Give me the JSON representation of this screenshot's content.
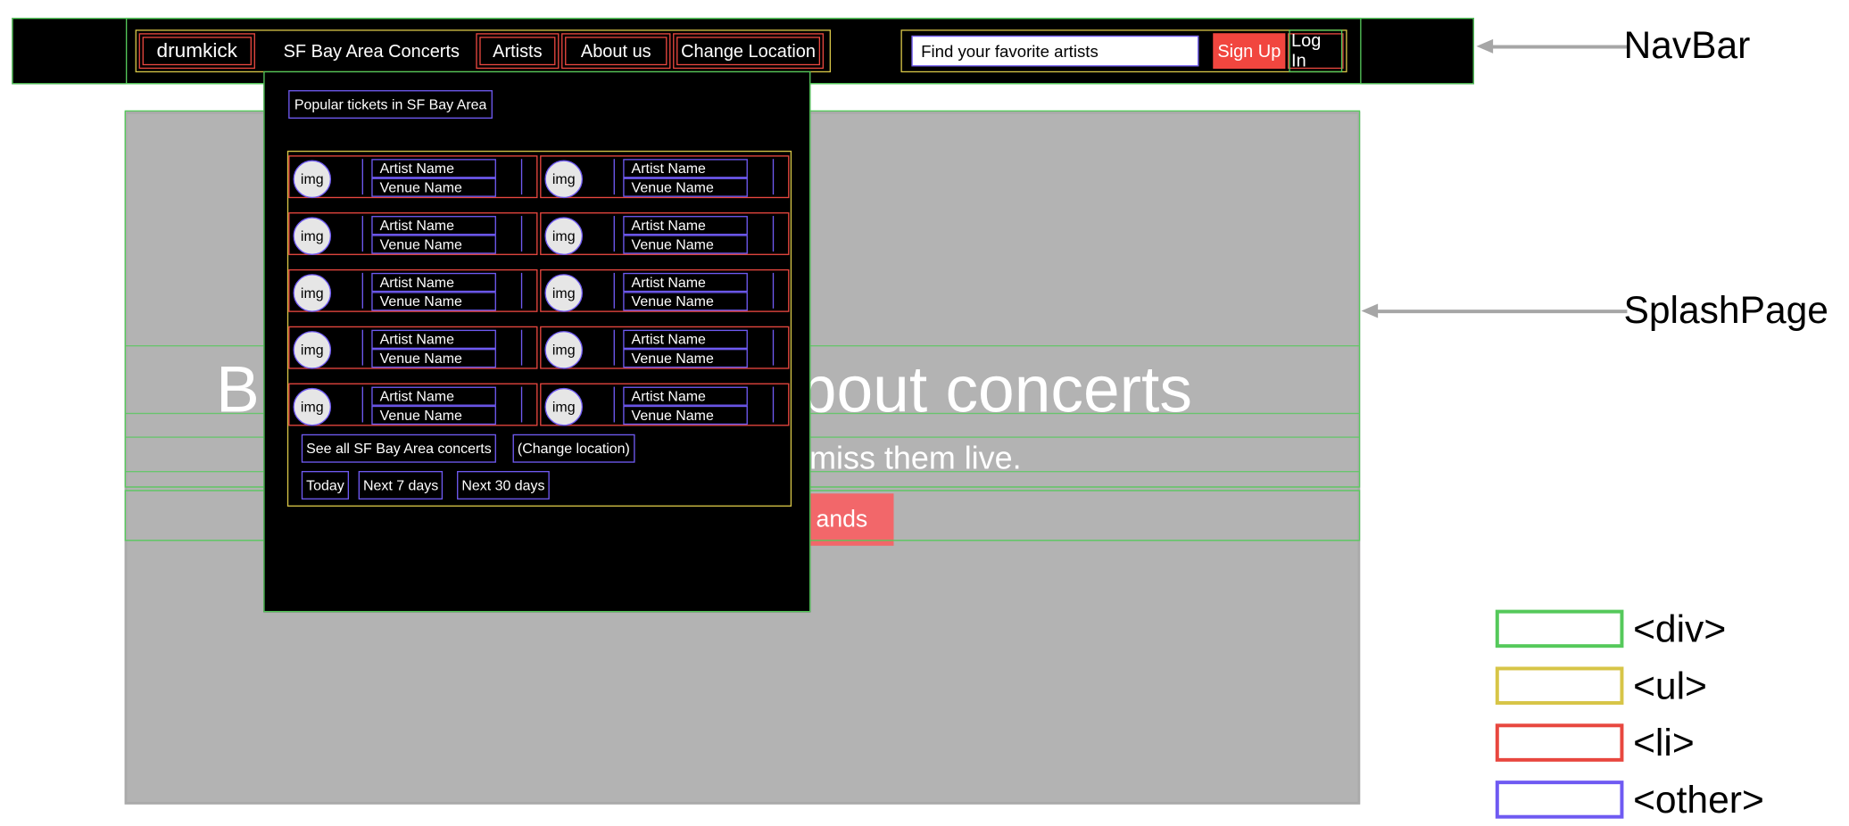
{
  "navbar": {
    "brand": "drumkick",
    "items": [
      "SF Bay Area Concerts",
      "Artists",
      "About us",
      "Change Location"
    ],
    "search_placeholder": "Find your favorite artists",
    "signup_label": "Sign Up",
    "login_label": "Log In"
  },
  "splash": {
    "title_left": "B",
    "title_right": "about concerts",
    "subtitle": "never miss them live.",
    "cta_label": "ands"
  },
  "dropdown": {
    "heading": "Popular tickets in SF Bay Area",
    "ticket_img_label": "img",
    "ticket_artist": "Artist Name",
    "ticket_venue": "Venue Name",
    "see_all": "See all SF Bay Area concerts",
    "change_location": "(Change location)",
    "filters": [
      "Today",
      "Next 7 days",
      "Next 30 days"
    ]
  },
  "annotations": {
    "navbar_label": "NavBar",
    "splash_label": "SplashPage"
  },
  "legend": [
    {
      "label": "<div>",
      "color": "#55c95b"
    },
    {
      "label": "<ul>",
      "color": "#d7c547"
    },
    {
      "label": "<li>",
      "color": "#e8473f"
    },
    {
      "label": "<other>",
      "color": "#6f5af2"
    }
  ]
}
